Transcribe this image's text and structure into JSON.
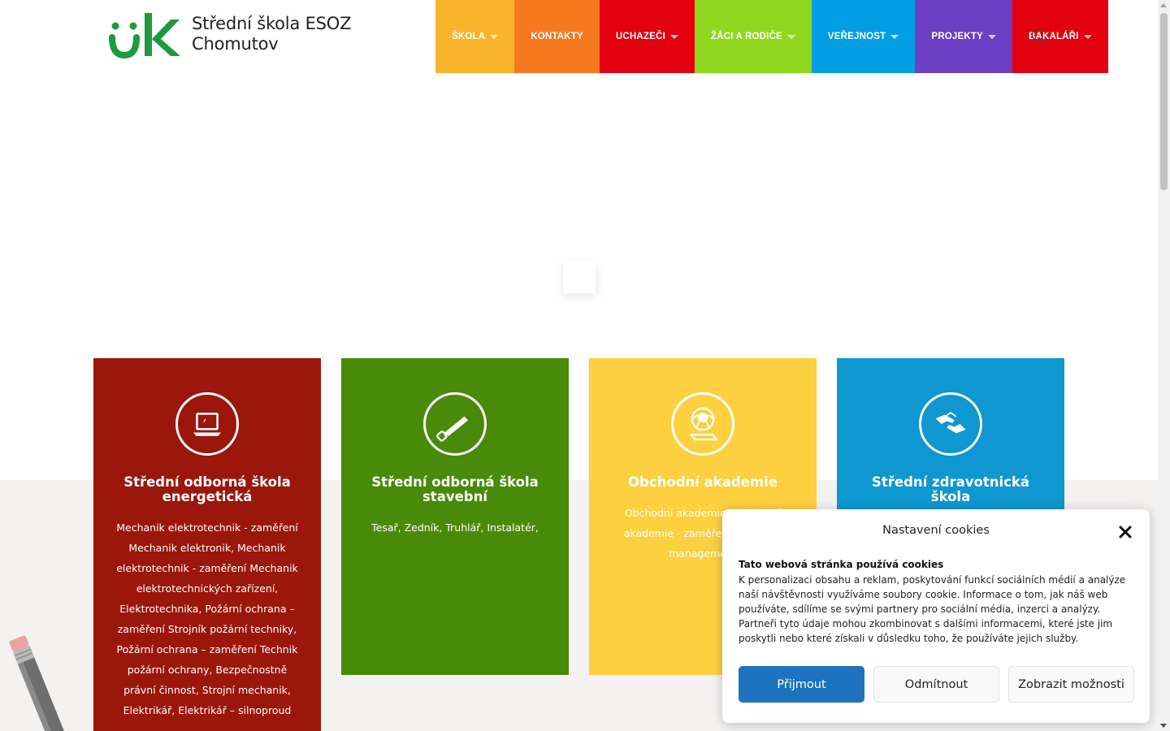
{
  "site": {
    "name_line1": "Střední škola ESOZ",
    "name_line2": "Chomutov",
    "logo_letters": "ük"
  },
  "nav": {
    "items": [
      {
        "label": "ŠKOLA",
        "color": "#f9b42d",
        "has_submenu": true
      },
      {
        "label": "KONTAKTY",
        "color": "#f7791f",
        "has_submenu": false
      },
      {
        "label": "UCHAZEČI",
        "color": "#e3000f",
        "has_submenu": true
      },
      {
        "label": "ŽÁCI A RODIČE",
        "color": "#8fd81f",
        "has_submenu": true
      },
      {
        "label": "VEŘEJNOST",
        "color": "#009fe3",
        "has_submenu": true
      },
      {
        "label": "PROJEKTY",
        "color": "#6d3fc4",
        "has_submenu": true
      },
      {
        "label": "BAKALÁŘI",
        "color": "#e3000f",
        "has_submenu": true
      }
    ],
    "search_icon": "search-icon"
  },
  "cards": [
    {
      "title": "Střední odborná škola energetická",
      "icon": "laptop-icon",
      "color": "#9b160b",
      "text": "Mechanik elektrotechnik - zaměření Mechanik elektronik, Mechanik elektrotechnik - zaměření Mechanik elektrotechnických zařízení, Elektrotechnika, Požární ochrana – zaměření Strojník požární techniky, Požární ochrana – zaměření Technik požární ochrany, Bezpečnostně právní činnost, Strojní mechanik, Elektrikář, Elektrikář – silnoproud"
    },
    {
      "title": "Střední odborná škola stavební",
      "icon": "saw-icon",
      "color": "#4a8a0a",
      "text": "Tesař, Zedník, Truhlář, Instalatér,"
    },
    {
      "title": "Obchodní akademie",
      "icon": "globe-laptop-icon",
      "color": "#fcd03f",
      "text": "Obchodní akademie, Obchodní akademie - zaměření sportovní management"
    },
    {
      "title": "Střední zdravotnická škola",
      "icon": "helping-hands-icon",
      "color": "#0f97d1",
      "text": ""
    }
  ],
  "cookie": {
    "title": "Nastavení cookies",
    "heading": "Tato webová stránka používá cookies",
    "text": "K personalizaci obsahu a reklam, poskytování funkcí sociálních médií a analýze naší návštěvnosti využíváme soubory cookie. Informace o tom, jak náš web používáte, sdílíme se svými partnery pro sociální média, inzerci a analýzy. Partneři tyto údaje mohou zkombinovat s dalšími informacemi, které jste jim poskytli nebo které získali v důsledku toho, že používáte jejich služby.",
    "accept": "Přijmout",
    "deny": "Odmítnout",
    "preferences": "Zobrazit možnosti",
    "accent": "#1e73be"
  }
}
